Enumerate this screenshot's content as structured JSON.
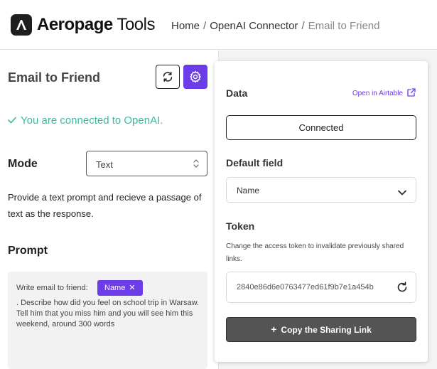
{
  "header": {
    "brand_bold": "Aeropage",
    "brand_light": " Tools",
    "breadcrumbs": [
      "Home",
      "OpenAI Connector",
      "Email to Friend"
    ],
    "separator": "/"
  },
  "left_panel": {
    "title": "Email to Friend",
    "connected_text": "You are connected to OpenAI.",
    "mode_label": "Mode",
    "mode_value": "Text",
    "mode_description": "Provide a text prompt and recieve a passage of text as the response.",
    "prompt_label": "Prompt",
    "prompt_prefix": "Write email to friend:",
    "prompt_chip": "Name",
    "prompt_suffix": ". Describe how did you feel on school trip in Warsaw. Tell him that you miss him and you will see him this weekend, around 300 words"
  },
  "card": {
    "data_title": "Data",
    "open_airtable": "Open in Airtable",
    "connected_button": "Connected",
    "default_field_title": "Default field",
    "default_field_value": "Name",
    "token_title": "Token",
    "token_description": "Change the access token to invalidate previously shared links.",
    "token_value": "2840e86d6e0763477ed61f9b7e1a454b",
    "copy_button": "Copy the Sharing Link"
  },
  "colors": {
    "accent": "#6c3ce9",
    "success": "#3cb8a0",
    "dark_button": "#545454"
  },
  "icons": [
    "aeropage-logo-icon",
    "refresh-icon",
    "gear-icon",
    "check-icon",
    "updown-arrows-icon",
    "close-icon",
    "external-link-icon",
    "chevron-down-icon",
    "plus-icon"
  ]
}
